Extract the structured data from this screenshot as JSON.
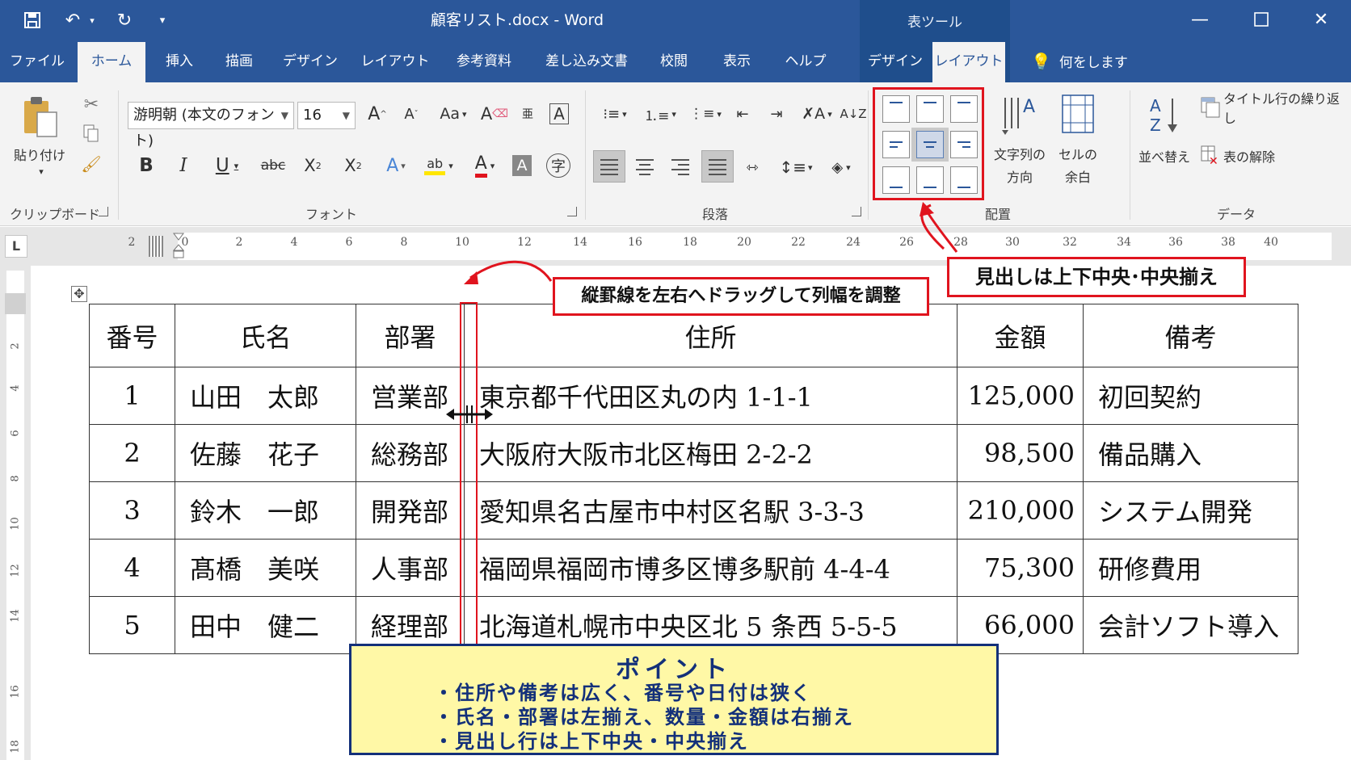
{
  "window": {
    "title": "顧客リスト.docx  -  Word",
    "context_group": "表ツール"
  },
  "tabs": [
    {
      "label": "ファイル"
    },
    {
      "label": "ホーム"
    },
    {
      "label": "挿入"
    },
    {
      "label": "描画"
    },
    {
      "label": "デザイン"
    },
    {
      "label": "レイアウト"
    },
    {
      "label": "参考資料"
    },
    {
      "label": "差し込み文書"
    },
    {
      "label": "校閲"
    },
    {
      "label": "表示"
    },
    {
      "label": "ヘルプ"
    },
    {
      "label": "デザイン"
    },
    {
      "label": "レイアウト"
    }
  ],
  "tell_me": "何をしますか",
  "ribbon": {
    "clipboard": {
      "paste_label": "貼り付け",
      "group": "クリップボード"
    },
    "font": {
      "name": "游明朝 (本文のフォント)",
      "size": "16",
      "group": "フォント"
    },
    "paragraph": {
      "group": "段落"
    },
    "alignment": {
      "text_direction_1": "文字列の",
      "text_direction_2": "方向",
      "cell_margin_1": "セルの",
      "cell_margin_2": "余白",
      "group": "配置"
    },
    "data": {
      "sort": "並べ替え",
      "repeat_header": "タイトル行の繰り返し",
      "convert": "表の解除",
      "group": "データ"
    }
  },
  "ruler": {
    "marks": [
      "2",
      "0",
      "2",
      "4",
      "6",
      "8",
      "10",
      "12",
      "14",
      "16",
      "18",
      "20",
      "22",
      "24",
      "26",
      "28",
      "30",
      "32",
      "34",
      "36",
      "38",
      "40"
    ],
    "vertical_marks": [
      "2",
      "4",
      "6",
      "8",
      "10",
      "12",
      "14",
      "16",
      "18"
    ]
  },
  "table": {
    "headers": [
      "番号",
      "氏名",
      "部署",
      "住所",
      "金額",
      "備考"
    ],
    "rows": [
      [
        "1",
        "山田　太郎",
        "営業部",
        "東京都千代田区丸の内 1-1-1",
        "125,000",
        "初回契約"
      ],
      [
        "2",
        "佐藤　花子",
        "総務部",
        "大阪府大阪市北区梅田 2-2-2",
        "98,500",
        "備品購入"
      ],
      [
        "3",
        "鈴木　一郎",
        "開発部",
        "愛知県名古屋市中村区名駅 3-3-3",
        "210,000",
        "システム開発"
      ],
      [
        "4",
        "髙橋　美咲",
        "人事部",
        "福岡県福岡市博多区博多駅前 4-4-4",
        "75,300",
        "研修費用"
      ],
      [
        "5",
        "田中　健二",
        "経理部",
        "北海道札幌市中央区北 5 条西 5-5-5",
        "66,000",
        "会計ソフト導入"
      ]
    ]
  },
  "annotations": {
    "column_drag": "縦罫線を左右へドラッグして列幅を調整",
    "header_align": "見出しは上下中央･中央揃え",
    "point_title": "ポイント",
    "point_lines": [
      "・住所や備考は広く、番号や日付は狭く",
      "・氏名・部署は左揃え、数量・金額は右揃え",
      "・見出し行は上下中央・中央揃え"
    ]
  },
  "colors": {
    "accent": "#2b579a",
    "callout_border": "#e0141e",
    "point_bg": "#fff8a6",
    "point_text": "#13307a"
  }
}
